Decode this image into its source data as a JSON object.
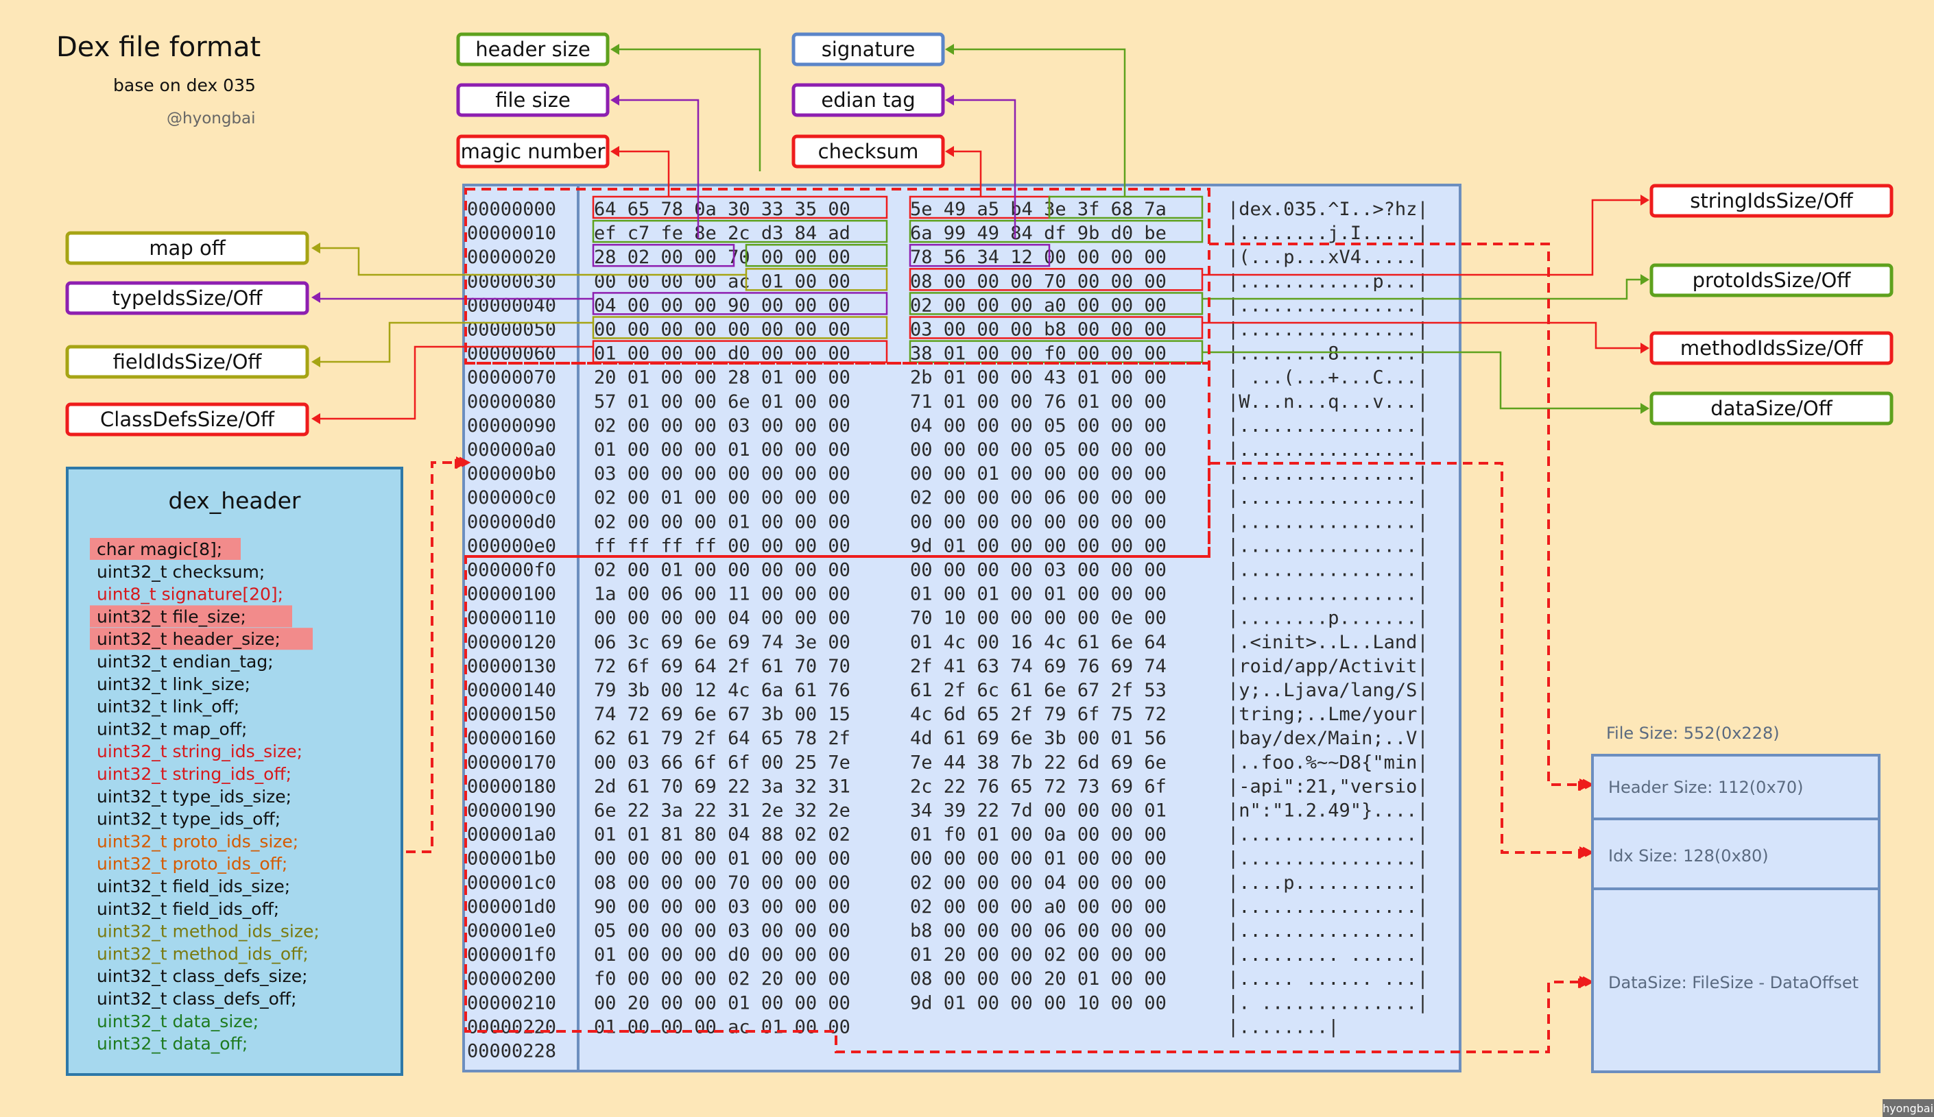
{
  "title": "Dex file format",
  "subtitle": "base on dex 035",
  "author": "@hyongbai",
  "watermark": "hyongbai",
  "colors": {
    "background": "#fde7b8",
    "panel_blue": "#d6e4fb",
    "panel_blue_border": "#6c8ebf",
    "dex_header_bg": "#a6d8ee",
    "red": "#ee1c1c",
    "green": "#5ea11d",
    "purple": "#8d1fb0",
    "olive": "#a6a414",
    "dash_red": "#ee1c1c",
    "blue_label": "#5b85c8"
  },
  "top_labels": [
    {
      "text": "header size",
      "color": "green"
    },
    {
      "text": "file size",
      "color": "purple"
    },
    {
      "text": "magic number",
      "color": "red"
    },
    {
      "text": "signature",
      "color": "blue_label"
    },
    {
      "text": "edian tag",
      "color": "purple"
    },
    {
      "text": "checksum",
      "color": "red"
    }
  ],
  "left_labels": [
    {
      "text": "map off",
      "color": "olive"
    },
    {
      "text": "typeIdsSize/Off",
      "color": "purple"
    },
    {
      "text": "fieldIdsSize/Off",
      "color": "olive"
    },
    {
      "text": "ClassDefsSize/Off",
      "color": "red"
    }
  ],
  "right_labels": [
    {
      "text": "stringIdsSize/Off",
      "color": "red"
    },
    {
      "text": "protoIdsSize/Off",
      "color": "green"
    },
    {
      "text": "methodIdsSize/Off",
      "color": "red"
    },
    {
      "text": "dataSize/Off",
      "color": "green"
    }
  ],
  "hexdump": {
    "rows": [
      {
        "off": "00000000",
        "a": "64 65 78 0a 30 33 35 00",
        "b": "5e 49 a5 b4 3e 3f 68 7a",
        "asc": "|dex.035.^I..>?hz|"
      },
      {
        "off": "00000010",
        "a": "ef c7 fe 8e 2c d3 84 ad",
        "b": "6a 99 49 84 df 9b d0 be",
        "asc": "|........j.I.....|"
      },
      {
        "off": "00000020",
        "a": "28 02 00 00 70 00 00 00",
        "b": "78 56 34 12 00 00 00 00",
        "asc": "|(...p...xV4.....|"
      },
      {
        "off": "00000030",
        "a": "00 00 00 00 ac 01 00 00",
        "b": "08 00 00 00 70 00 00 00",
        "asc": "|............p...|"
      },
      {
        "off": "00000040",
        "a": "04 00 00 00 90 00 00 00",
        "b": "02 00 00 00 a0 00 00 00",
        "asc": "|................|"
      },
      {
        "off": "00000050",
        "a": "00 00 00 00 00 00 00 00",
        "b": "03 00 00 00 b8 00 00 00",
        "asc": "|................|"
      },
      {
        "off": "00000060",
        "a": "01 00 00 00 d0 00 00 00",
        "b": "38 01 00 00 f0 00 00 00",
        "asc": "|........8.......|"
      },
      {
        "off": "00000070",
        "a": "20 01 00 00 28 01 00 00",
        "b": "2b 01 00 00 43 01 00 00",
        "asc": "| ...(...+...C...|"
      },
      {
        "off": "00000080",
        "a": "57 01 00 00 6e 01 00 00",
        "b": "71 01 00 00 76 01 00 00",
        "asc": "|W...n...q...v...|"
      },
      {
        "off": "00000090",
        "a": "02 00 00 00 03 00 00 00",
        "b": "04 00 00 00 05 00 00 00",
        "asc": "|................|"
      },
      {
        "off": "000000a0",
        "a": "01 00 00 00 01 00 00 00",
        "b": "00 00 00 00 05 00 00 00",
        "asc": "|................|"
      },
      {
        "off": "000000b0",
        "a": "03 00 00 00 00 00 00 00",
        "b": "00 00 01 00 00 00 00 00",
        "asc": "|................|"
      },
      {
        "off": "000000c0",
        "a": "02 00 01 00 00 00 00 00",
        "b": "02 00 00 00 06 00 00 00",
        "asc": "|................|"
      },
      {
        "off": "000000d0",
        "a": "02 00 00 00 01 00 00 00",
        "b": "00 00 00 00 00 00 00 00",
        "asc": "|................|"
      },
      {
        "off": "000000e0",
        "a": "ff ff ff ff 00 00 00 00",
        "b": "9d 01 00 00 00 00 00 00",
        "asc": "|................|"
      },
      {
        "off": "000000f0",
        "a": "02 00 01 00 00 00 00 00",
        "b": "00 00 00 00 03 00 00 00",
        "asc": "|................|"
      },
      {
        "off": "00000100",
        "a": "1a 00 06 00 11 00 00 00",
        "b": "01 00 01 00 01 00 00 00",
        "asc": "|................|"
      },
      {
        "off": "00000110",
        "a": "00 00 00 00 04 00 00 00",
        "b": "70 10 00 00 00 00 0e 00",
        "asc": "|........p.......|"
      },
      {
        "off": "00000120",
        "a": "06 3c 69 6e 69 74 3e 00",
        "b": "01 4c 00 16 4c 61 6e 64",
        "asc": "|.<init>..L..Land|"
      },
      {
        "off": "00000130",
        "a": "72 6f 69 64 2f 61 70 70",
        "b": "2f 41 63 74 69 76 69 74",
        "asc": "|roid/app/Activit|"
      },
      {
        "off": "00000140",
        "a": "79 3b 00 12 4c 6a 61 76",
        "b": "61 2f 6c 61 6e 67 2f 53",
        "asc": "|y;..Ljava/lang/S|"
      },
      {
        "off": "00000150",
        "a": "74 72 69 6e 67 3b 00 15",
        "b": "4c 6d 65 2f 79 6f 75 72",
        "asc": "|tring;..Lme/your|"
      },
      {
        "off": "00000160",
        "a": "62 61 79 2f 64 65 78 2f",
        "b": "4d 61 69 6e 3b 00 01 56",
        "asc": "|bay/dex/Main;..V|"
      },
      {
        "off": "00000170",
        "a": "00 03 66 6f 6f 00 25 7e",
        "b": "7e 44 38 7b 22 6d 69 6e",
        "asc": "|..foo.%~~D8{\"min|"
      },
      {
        "off": "00000180",
        "a": "2d 61 70 69 22 3a 32 31",
        "b": "2c 22 76 65 72 73 69 6f",
        "asc": "|-api\":21,\"versio|"
      },
      {
        "off": "00000190",
        "a": "6e 22 3a 22 31 2e 32 2e",
        "b": "34 39 22 7d 00 00 00 01",
        "asc": "|n\":\"1.2.49\"}....|"
      },
      {
        "off": "000001a0",
        "a": "01 01 81 80 04 88 02 02",
        "b": "01 f0 01 00 0a 00 00 00",
        "asc": "|................|"
      },
      {
        "off": "000001b0",
        "a": "00 00 00 00 01 00 00 00",
        "b": "00 00 00 00 01 00 00 00",
        "asc": "|................|"
      },
      {
        "off": "000001c0",
        "a": "08 00 00 00 70 00 00 00",
        "b": "02 00 00 00 04 00 00 00",
        "asc": "|....p...........|"
      },
      {
        "off": "000001d0",
        "a": "90 00 00 00 03 00 00 00",
        "b": "02 00 00 00 a0 00 00 00",
        "asc": "|................|"
      },
      {
        "off": "000001e0",
        "a": "05 00 00 00 03 00 00 00",
        "b": "b8 00 00 00 06 00 00 00",
        "asc": "|................|"
      },
      {
        "off": "000001f0",
        "a": "01 00 00 00 d0 00 00 00",
        "b": "01 20 00 00 02 00 00 00",
        "asc": "|......... ......|"
      },
      {
        "off": "00000200",
        "a": "f0 00 00 00 02 20 00 00",
        "b": "08 00 00 00 20 01 00 00",
        "asc": "|..... ...... ...|"
      },
      {
        "off": "00000210",
        "a": "00 20 00 00 01 00 00 00",
        "b": "9d 01 00 00 00 10 00 00",
        "asc": "|. ..............|"
      },
      {
        "off": "00000220",
        "a": "01 00 00 00 ac 01 00 00",
        "b": "",
        "asc": "|........|"
      },
      {
        "off": "00000228",
        "a": "",
        "b": "",
        "asc": ""
      }
    ]
  },
  "dex_header": {
    "title": "dex_header",
    "fields": [
      {
        "text": "char magic[8];",
        "color": "black",
        "hl": true
      },
      {
        "text": "uint32_t checksum;",
        "color": "black",
        "hl": false
      },
      {
        "text": "uint8_t signature[20];",
        "color": "red",
        "hl": false
      },
      {
        "text": "uint32_t file_size;",
        "color": "black",
        "hl": true
      },
      {
        "text": "uint32_t header_size;",
        "color": "black",
        "hl": true
      },
      {
        "text": "uint32_t endian_tag;",
        "color": "black",
        "hl": false
      },
      {
        "text": "uint32_t link_size;",
        "color": "black",
        "hl": false
      },
      {
        "text": "uint32_t link_off;",
        "color": "black",
        "hl": false
      },
      {
        "text": "uint32_t map_off;",
        "color": "black",
        "hl": false
      },
      {
        "text": "uint32_t string_ids_size;",
        "color": "red",
        "hl": false
      },
      {
        "text": "uint32_t string_ids_off;",
        "color": "red",
        "hl": false
      },
      {
        "text": "uint32_t type_ids_size;",
        "color": "black",
        "hl": false
      },
      {
        "text": "uint32_t type_ids_off;",
        "color": "black",
        "hl": false
      },
      {
        "text": "uint32_t proto_ids_size;",
        "color": "orange",
        "hl": false
      },
      {
        "text": "uint32_t proto_ids_off;",
        "color": "orange",
        "hl": false
      },
      {
        "text": "uint32_t field_ids_size;",
        "color": "black",
        "hl": false
      },
      {
        "text": "uint32_t field_ids_off;",
        "color": "black",
        "hl": false
      },
      {
        "text": "uint32_t method_ids_size;",
        "color": "olive",
        "hl": false
      },
      {
        "text": "uint32_t method_ids_off;",
        "color": "olive",
        "hl": false
      },
      {
        "text": "uint32_t class_defs_size;",
        "color": "black",
        "hl": false
      },
      {
        "text": "uint32_t class_defs_off;",
        "color": "black",
        "hl": false
      },
      {
        "text": "uint32_t data_size;",
        "color": "darkgreen",
        "hl": false
      },
      {
        "text": "uint32_t data_off;",
        "color": "darkgreen",
        "hl": false
      }
    ]
  },
  "file_size_panel": {
    "caption": "File Size: 552(0x228)",
    "sections": [
      {
        "text": "Header Size: 112(0x70)"
      },
      {
        "text": "Idx Size: 128(0x80)"
      },
      {
        "text": "DataSize: FileSize - DataOffset"
      }
    ]
  }
}
